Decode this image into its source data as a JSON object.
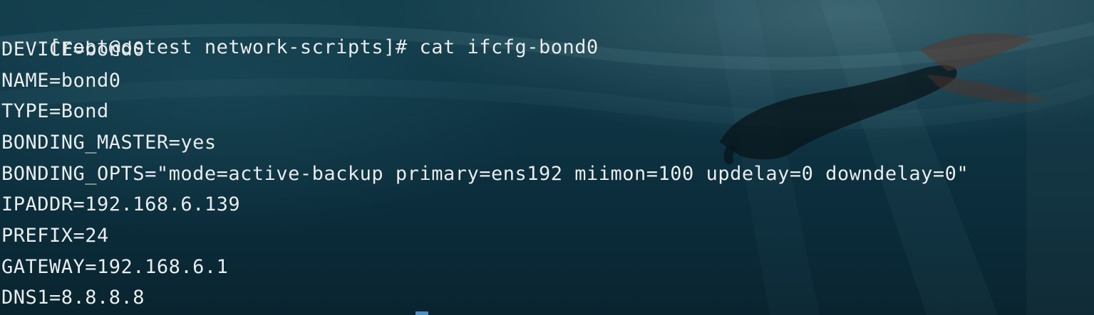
{
  "terminal": {
    "prompt": "[root@ostest network-scripts]#",
    "command": "cat ifcfg-bond0",
    "output_lines": [
      "DEVICE=bond0",
      "NAME=bond0",
      "TYPE=Bond",
      "BONDING_MASTER=yes",
      "BONDING_OPTS=\"mode=active-backup primary=ens192 miimon=100 updelay=0 downdelay=0\"",
      "IPADDR=192.168.6.139",
      "PREFIX=24",
      "GATEWAY=192.168.6.1",
      "DNS1=8.8.8.8"
    ]
  },
  "colors": {
    "text": "#e9eef0",
    "background": "#0b2a36",
    "cursor": "#4a8fc4"
  },
  "background_image": "underwater-diver-silhouette"
}
